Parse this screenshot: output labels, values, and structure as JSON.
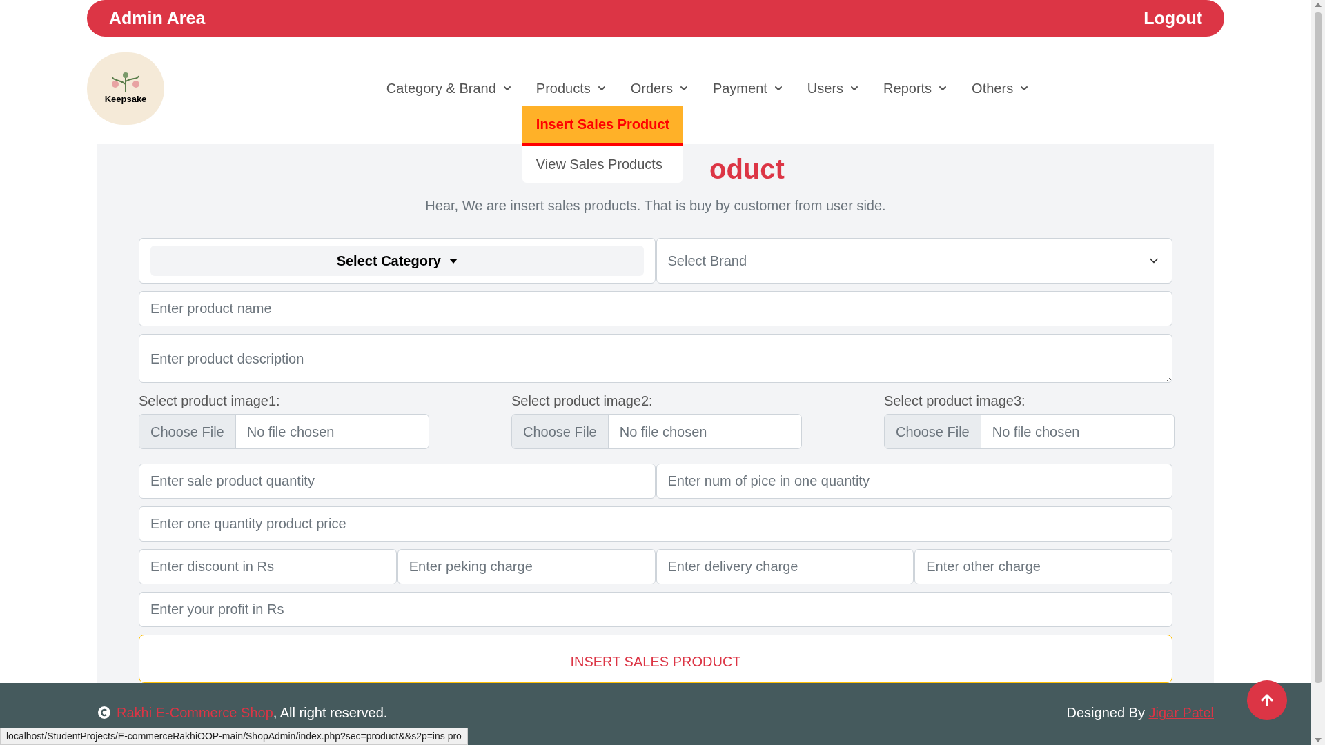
{
  "header": {
    "title": "Admin Area",
    "logout": "Logout"
  },
  "logo": {
    "text": "Keepsake"
  },
  "nav": [
    {
      "label": "Category & Brand"
    },
    {
      "label": "Products",
      "menu": [
        {
          "label": "Insert Sales Product",
          "selected": true
        },
        {
          "label": "View Sales Products",
          "selected": false
        }
      ]
    },
    {
      "label": "Orders"
    },
    {
      "label": "Payment"
    },
    {
      "label": "Users"
    },
    {
      "label": "Reports"
    },
    {
      "label": "Others"
    }
  ],
  "heading": "oduct",
  "subtitle": "Hear, We are insert sales products. That is buy by customer from user side.",
  "form": [
    [
      {
        "kind": "dropdown_button",
        "label": "Select Category"
      },
      {
        "kind": "select",
        "placeholder": "Select Brand"
      }
    ],
    [
      {
        "kind": "input",
        "placeholder": "Enter product name"
      }
    ],
    [
      {
        "kind": "textarea",
        "placeholder": "Enter product description"
      }
    ],
    [
      {
        "kind": "file",
        "label": "Select product image1:",
        "button": "Choose File",
        "status": "No file chosen"
      },
      {
        "kind": "file",
        "label": "Select product image2:",
        "button": "Choose File",
        "status": "No file chosen"
      },
      {
        "kind": "file",
        "label": "Select product image3:",
        "button": "Choose File",
        "status": "No file chosen"
      }
    ],
    [
      {
        "kind": "input",
        "placeholder": "Enter sale product quantity"
      },
      {
        "kind": "input",
        "placeholder": "Enter num of pice in one quantity"
      }
    ],
    [
      {
        "kind": "input",
        "placeholder": "Enter one quantity product price"
      }
    ],
    [
      {
        "kind": "input",
        "placeholder": "Enter discount in Rs"
      },
      {
        "kind": "input",
        "placeholder": "Enter peking charge"
      },
      {
        "kind": "input",
        "placeholder": "Enter delivery charge"
      },
      {
        "kind": "input",
        "placeholder": "Enter other charge"
      }
    ],
    [
      {
        "kind": "input",
        "placeholder": "Enter your profit in Rs"
      }
    ],
    [
      {
        "kind": "submit",
        "label": "INSERT SALES PRODUCT"
      }
    ]
  ],
  "footer": {
    "shop": "Rakhi E-Commerce Shop",
    "rights": ", All right reserved.",
    "designed_by": "Designed By",
    "designer": "Jigar Patel"
  },
  "status_bar": {
    "url": "localhost/StudentProjects/E-commerceRakhiOOP-main/ShopAdmin/index.php?sec=product&&s2p=ins pro"
  }
}
